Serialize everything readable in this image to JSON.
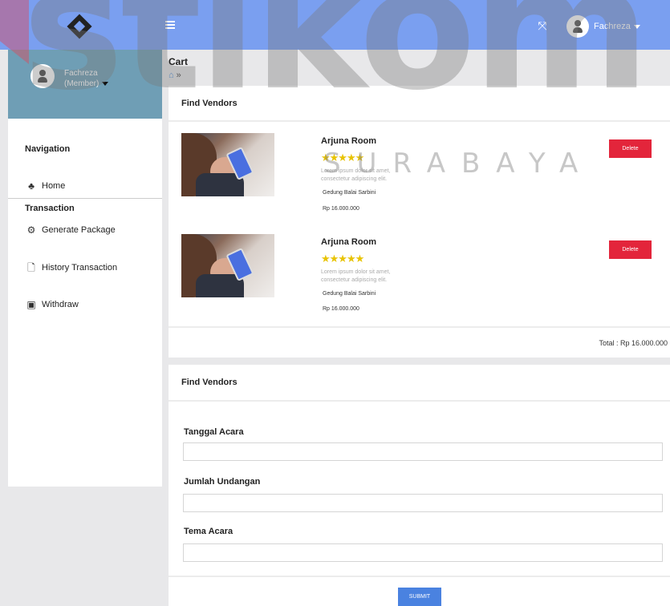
{
  "header": {
    "user_name": "Fachreza",
    "menu_icon": "hamburger-icon",
    "fullscreen_icon": "fullscreen-icon"
  },
  "sidebar": {
    "profile_name": "Fachreza",
    "profile_role": "(Member)",
    "navigation_heading": "Navigation",
    "home_label": "Home",
    "transaction_heading": "Transaction",
    "items": [
      {
        "label": "Generate Package",
        "icon": "gears-icon"
      },
      {
        "label": "History Transaction",
        "icon": "file-icon"
      },
      {
        "label": "Withdraw",
        "icon": "money-icon"
      }
    ]
  },
  "main": {
    "title": "Cart",
    "cart_card": {
      "header": "Find Vendors",
      "vendors": [
        {
          "name": "Arjuna Room",
          "stars": "★★★★★",
          "description": "Lorem ipsum dolor sit amet, consectetur adipiscing elit.",
          "location": "Gedung Balai Sarbini",
          "price": "Rp 16.000.000",
          "delete_label": "Delete"
        },
        {
          "name": "Arjuna Room",
          "stars": "★★★★★",
          "description": "Lorem ipsum dolor sit amet, consectetur adipiscing elit.",
          "location": "Gedung Balai Sarbini",
          "price": "Rp 16.000.000",
          "delete_label": "Delete"
        }
      ],
      "total": "Total : Rp 16.000.000"
    },
    "form_card": {
      "header": "Find Vendors",
      "fields": [
        {
          "label": "Tanggal Acara",
          "value": "",
          "placeholder": ""
        },
        {
          "label": "Jumlah Undangan",
          "value": "",
          "placeholder": ""
        },
        {
          "label": "Tema Acara",
          "value": "",
          "placeholder": ""
        }
      ],
      "submit_label": "SUBMIT"
    }
  },
  "watermark": {
    "big": "stikom",
    "small": "SURABAYA"
  },
  "colors": {
    "topbar": "#7a9ff0",
    "profile_bg": "#6f9eb5",
    "delete": "#e3253b",
    "submit": "#4a82e0",
    "stars": "#e8c300"
  }
}
